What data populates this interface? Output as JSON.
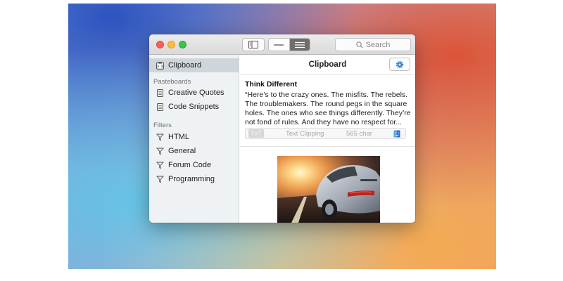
{
  "toolbar": {
    "search_placeholder": "Search"
  },
  "sidebar": {
    "selected_item": "Clipboard",
    "pasteboards_header": "Pasteboards",
    "pasteboards": [
      {
        "label": "Creative Quotes",
        "icon": "document-icon"
      },
      {
        "label": "Code Snippets",
        "icon": "document-icon"
      }
    ],
    "filters_header": "Filters",
    "filters": [
      {
        "label": "HTML",
        "icon": "filter-icon"
      },
      {
        "label": "General",
        "icon": "filter-icon"
      },
      {
        "label": "Forum Code",
        "icon": "filter-icon"
      },
      {
        "label": "Programming",
        "icon": "filter-icon"
      }
    ],
    "add_label": "+"
  },
  "main": {
    "title": "Clipboard",
    "clip": {
      "title": "Think Different",
      "body": "“Here’s to the crazy ones. The misfits. The rebels. The troublemakers. The round pegs in the square holes. The ones who see things differently. They’re not fond of rules. And they have no respect for...",
      "badge": "TXT",
      "type": "Text Clipping",
      "count": "565 char"
    }
  },
  "colors": {
    "close": "#fc605b",
    "minimize": "#fdbc40",
    "maximize": "#34c84a",
    "accent": "#2f7fd8"
  }
}
